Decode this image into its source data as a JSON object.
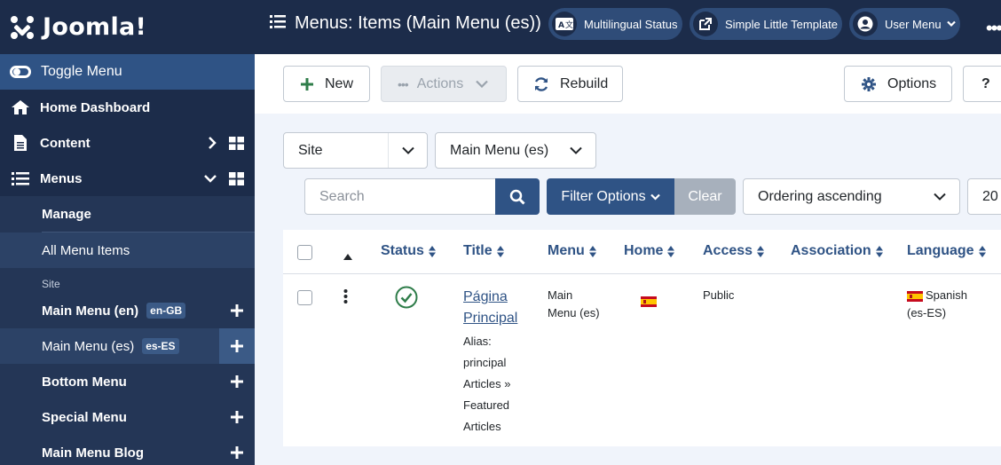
{
  "sidebar": {
    "logo": "Joomla!",
    "toggle": "Toggle Menu",
    "home": "Home Dashboard",
    "content": "Content",
    "menus": "Menus",
    "manage": "Manage",
    "all_items": "All Menu Items",
    "site_heading": "Site",
    "menu_items": [
      {
        "label": "Main Menu (en)",
        "badge": "en-GB"
      },
      {
        "label": "Main Menu (es)",
        "badge": "es-ES"
      },
      {
        "label": "Bottom Menu",
        "badge": ""
      },
      {
        "label": "Special Menu",
        "badge": ""
      },
      {
        "label": "Main Menu Blog",
        "badge": ""
      }
    ]
  },
  "header": {
    "title": "Menus: Items (Main Menu (es))",
    "multilingual": "Multilingual Status",
    "template": "Simple Little Template",
    "user": "User Menu",
    "more": "•••"
  },
  "toolbar": {
    "new": "New",
    "actions": "Actions",
    "rebuild": "Rebuild",
    "options": "Options",
    "help": "?"
  },
  "filters": {
    "client": "Site",
    "menu": "Main Menu (es)",
    "search_placeholder": "Search",
    "filter_options": "Filter Options",
    "clear": "Clear",
    "ordering": "Ordering ascending",
    "limit": "20"
  },
  "table": {
    "headers": {
      "status": "Status",
      "title": "Title",
      "menu": "Menu",
      "home": "Home",
      "access": "Access",
      "association": "Association",
      "language": "Language"
    },
    "row": {
      "title": "Página Principal",
      "alias": "Alias: principal",
      "type": "Articles » Featured Articles",
      "menu": "Main Menu (es)",
      "access": "Public",
      "language": "Spanish (es-ES)"
    }
  },
  "colors": {
    "sidebar": "#1c2c4a",
    "accent": "#2f5385",
    "published": "#2f7d4a"
  }
}
